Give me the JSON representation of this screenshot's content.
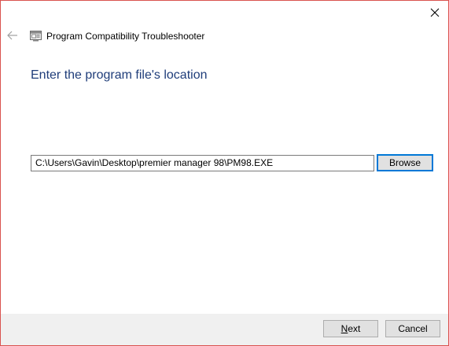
{
  "window": {
    "title": "Program Compatibility Troubleshooter",
    "accent_border": "#d9534f"
  },
  "icons": {
    "close": "close-icon",
    "back": "back-arrow-icon",
    "app": "troubleshooter-app-icon"
  },
  "page": {
    "heading": "Enter the program file's location"
  },
  "location": {
    "value": "C:\\Users\\Gavin\\Desktop\\premier manager 98\\PM98.EXE"
  },
  "buttons": {
    "browse": "Browse",
    "next": "Next",
    "cancel": "Cancel"
  },
  "colors": {
    "heading": "#1f3d7a",
    "footer_bg": "#f0f0f0",
    "button_bg": "#e1e1e1",
    "focus_border": "#0078d7"
  }
}
